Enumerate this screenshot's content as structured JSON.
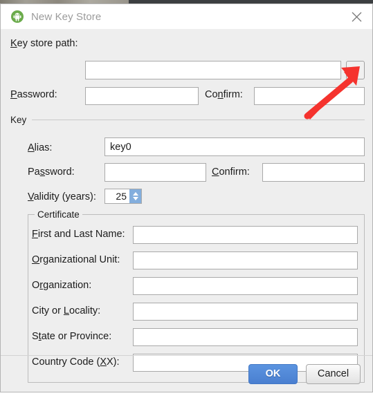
{
  "window": {
    "title": "New Key Store",
    "icon": "android-robot-icon",
    "close_label": "✕"
  },
  "keystore": {
    "path_label": {
      "pre": "",
      "mnemonic": "K",
      "post": "ey store path:"
    },
    "path_value": "",
    "browse_label": "...",
    "password_label": {
      "pre": "",
      "mnemonic": "P",
      "post": "assword:"
    },
    "password_value": "",
    "confirm_label": {
      "pre": "Co",
      "mnemonic": "n",
      "post": "firm:"
    },
    "confirm_value": ""
  },
  "key_section": {
    "title": "Key",
    "alias_label": {
      "pre": "",
      "mnemonic": "A",
      "post": "lias:"
    },
    "alias_value": "key0",
    "password_label": {
      "pre": "Pa",
      "mnemonic": "s",
      "post": "sword:"
    },
    "password_value": "",
    "confirm_label": {
      "pre": "",
      "mnemonic": "C",
      "post": "onfirm:"
    },
    "confirm_value": "",
    "validity_label": {
      "pre": "",
      "mnemonic": "V",
      "post": "alidity (years):"
    },
    "validity_value": "25"
  },
  "certificate": {
    "title": "Certificate",
    "fields": [
      {
        "pre": "",
        "mnemonic": "F",
        "post": "irst and Last Name:",
        "value": ""
      },
      {
        "pre": "",
        "mnemonic": "O",
        "post": "rganizational Unit:",
        "value": ""
      },
      {
        "pre": "O",
        "mnemonic": "r",
        "post": "ganization:",
        "value": ""
      },
      {
        "pre": "City or ",
        "mnemonic": "L",
        "post": "ocality:",
        "value": ""
      },
      {
        "pre": "S",
        "mnemonic": "t",
        "post": "ate or Province:",
        "value": ""
      },
      {
        "pre": "Country Code (",
        "mnemonic": "X",
        "post": "X):",
        "value": ""
      }
    ]
  },
  "buttons": {
    "ok": "OK",
    "cancel": "Cancel"
  },
  "annotation": {
    "arrow_color": "#f5332e"
  },
  "colors": {
    "dialog_bg": "#eeeeee",
    "titlebar_bg": "#ffffff",
    "title_text": "#9b9b9b",
    "field_bg": "#ffffff",
    "field_border": "#a9a9a9",
    "ok_button": "#4a7fd0",
    "spinner_accent": "#83aedd"
  }
}
